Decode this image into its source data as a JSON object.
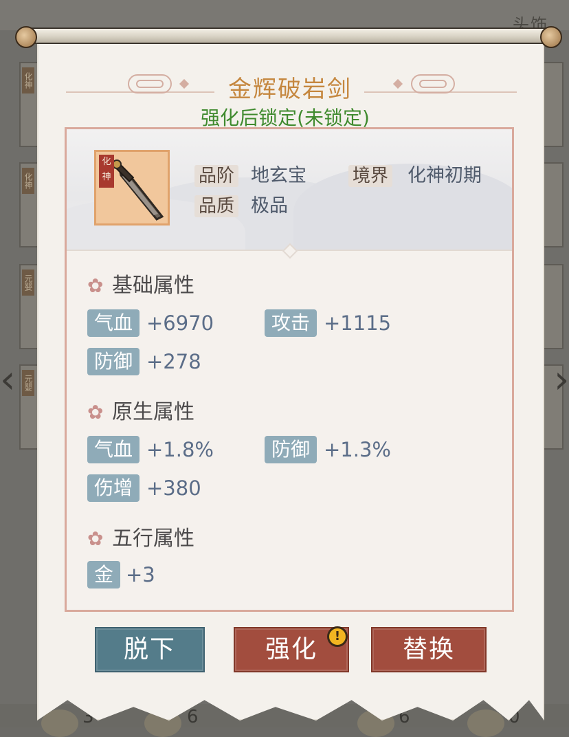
{
  "background": {
    "slot_label_top_right": "头饰",
    "slot_tags": [
      "化神",
      "化神",
      "元婴",
      "元婴"
    ],
    "bottom_counts": [
      "3",
      "6",
      "6",
      "0"
    ]
  },
  "item": {
    "name": "金辉破岩剑",
    "lock_status": "强化后锁定(未锁定)",
    "icon_realm_tag": "化神",
    "grade_label": "品阶",
    "grade_value": "地玄宝",
    "realm_label": "境界",
    "realm_value": "化神初期",
    "quality_label": "品质",
    "quality_value": "极品"
  },
  "sections": {
    "base": {
      "title": "基础属性",
      "stats": [
        {
          "name": "气血",
          "value": "+6970"
        },
        {
          "name": "攻击",
          "value": "+1115"
        },
        {
          "name": "防御",
          "value": "+278"
        }
      ]
    },
    "native": {
      "title": "原生属性",
      "stats": [
        {
          "name": "气血",
          "value": "+1.8%"
        },
        {
          "name": "防御",
          "value": "+1.3%"
        },
        {
          "name": "伤增",
          "value": "+380"
        }
      ]
    },
    "elements": {
      "title": "五行属性",
      "stats": [
        {
          "name": "金",
          "value": "+3"
        }
      ]
    }
  },
  "buttons": {
    "unequip": "脱下",
    "enhance": "强化",
    "replace": "替换",
    "enhance_badge": "!"
  },
  "colors": {
    "title": "#c5873f",
    "lock_status": "#3f8a2e",
    "stat_tag": "#8fabb8",
    "button_blue": "#547c8a",
    "button_red": "#a24d3e"
  }
}
